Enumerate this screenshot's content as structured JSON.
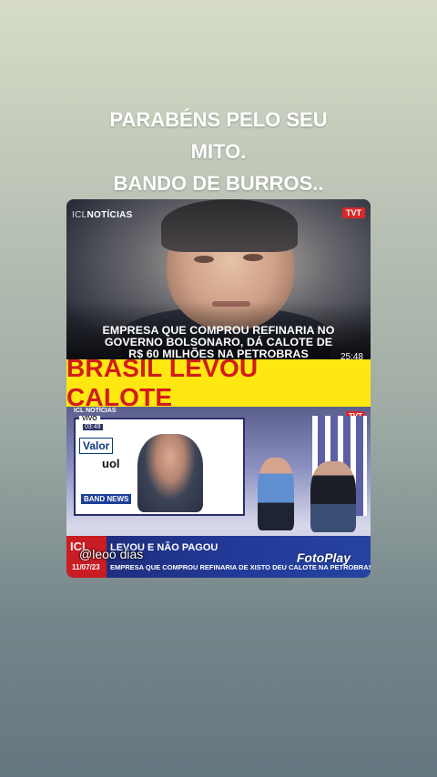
{
  "caption": {
    "line1": "PARABÉNS PELO SEU",
    "line2": "MITO.",
    "line3": "BANDO DE BURROS.."
  },
  "video_top": {
    "logo_bold_prefix": "ICL",
    "logo_text": "NOTÍCIAS",
    "channel_badge": "TVT",
    "headline_line1": "EMPRESA QUE COMPROU REFINARIA NO",
    "headline_line2": "GOVERNO BOLSONARO, DÁ CALOTE DE",
    "headline_line3": "R$ 60 MILHÕES NA PETROBRAS",
    "timestamp": "25:48"
  },
  "banner": {
    "text": "BRASIL LEVOU CALOTE"
  },
  "video_bottom": {
    "logo_text": "ICL NOTÍCIAS",
    "live_label": "VIVO",
    "clock": "03:49",
    "channel_badge": "TVT",
    "screen_logos": [
      "Valor",
      "uol",
      "BAND NEWS"
    ],
    "lower_third_logo": "ICL",
    "lower_third_title": "LEVOU E NÃO PAGOU",
    "lower_third_subtitle": "EMPRESA QUE COMPROU REFINARIA DE XISTO DEU CALOTE NA PETROBRAS",
    "date": "11/07/23",
    "watermark_handle": "@leoo dias",
    "watermark_brand": "FotoPlay"
  },
  "colors": {
    "banner_bg": "#ffe812",
    "banner_text": "#d11c1c",
    "tvt_red": "#d8282c",
    "lower_third_blue": "#233b9a"
  }
}
